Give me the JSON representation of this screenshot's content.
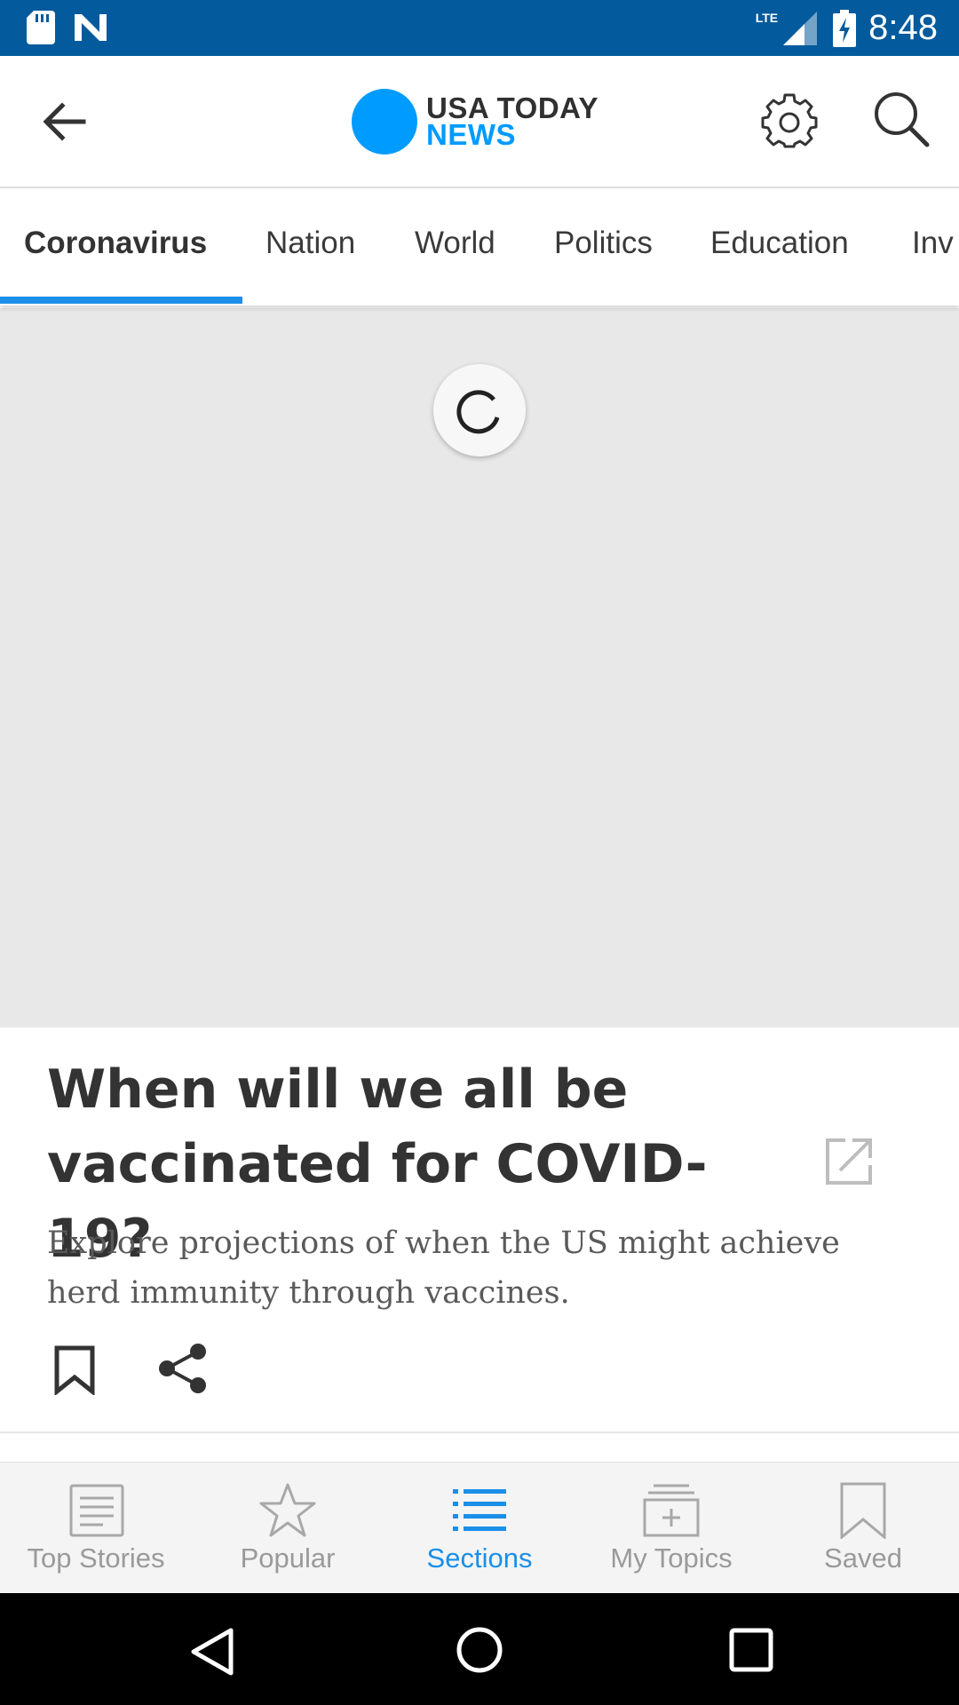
{
  "status_bar": {
    "time": "8:48",
    "network": "LTE",
    "icons": [
      "sd-card-icon",
      "n-notification-icon",
      "signal-icon",
      "battery-charging-icon"
    ]
  },
  "header": {
    "logo_line1": "USA TODAY",
    "logo_line2": "NEWS",
    "brand_color": "#009bff"
  },
  "tabs": {
    "items": [
      {
        "label": "Coronavirus",
        "active": true
      },
      {
        "label": "Nation",
        "active": false
      },
      {
        "label": "World",
        "active": false
      },
      {
        "label": "Politics",
        "active": false
      },
      {
        "label": "Education",
        "active": false
      },
      {
        "label": "Inv",
        "active": false
      }
    ],
    "accent": "#1a8fe8"
  },
  "article": {
    "headline": "When will we all be vaccinated for COVID-19?",
    "summary": "Explore projections of when the US might achieve herd immunity through vaccines."
  },
  "bottom_nav": {
    "items": [
      {
        "label": "Top Stories",
        "icon": "newspaper-icon",
        "active": false
      },
      {
        "label": "Popular",
        "icon": "star-icon",
        "active": false
      },
      {
        "label": "Sections",
        "icon": "list-icon",
        "active": true
      },
      {
        "label": "My Topics",
        "icon": "add-topics-icon",
        "active": false
      },
      {
        "label": "Saved",
        "icon": "bookmark-icon",
        "active": false
      }
    ]
  }
}
